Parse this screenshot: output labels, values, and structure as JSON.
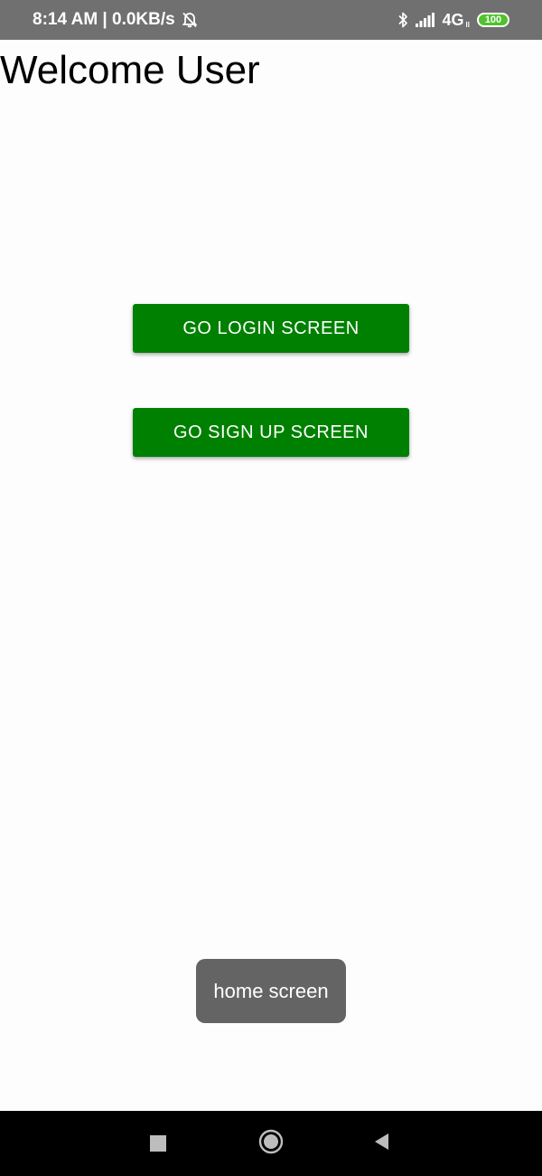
{
  "status_bar": {
    "time_speed": "8:14 AM | 0.0KB/s",
    "network": "4G",
    "network_sub": "ll",
    "battery": "100",
    "icons": [
      "alarm-off-icon",
      "bluetooth-icon",
      "signal-icon"
    ]
  },
  "main": {
    "title": "Welcome User",
    "login_button": "GO LOGIN SCREEN",
    "signup_button": "GO SIGN UP SCREEN"
  },
  "toast": {
    "message": "home screen"
  },
  "nav_bar": {
    "icons": [
      "recents-icon",
      "home-icon",
      "back-icon"
    ]
  },
  "colors": {
    "button_green": "#008001",
    "status_bar": "#6f706f",
    "toast": "#646464",
    "battery_green": "#4fc22c"
  }
}
